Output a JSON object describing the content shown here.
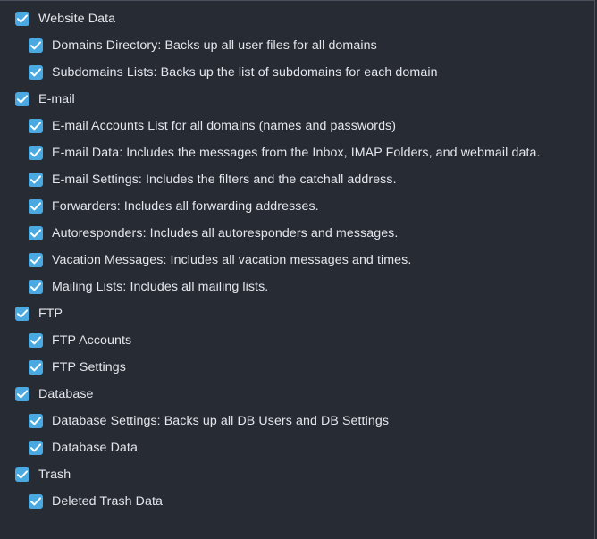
{
  "theme": {
    "background": "#272b34",
    "checkbox_color": "#4aa9e0",
    "text_color": "#e4e7ec"
  },
  "sections": [
    {
      "label": "Website Data",
      "checked": true,
      "items": [
        {
          "label": "Domains Directory: Backs up all user files for all domains",
          "checked": true
        },
        {
          "label": "Subdomains Lists: Backs up the list of subdomains for each domain",
          "checked": true
        }
      ]
    },
    {
      "label": "E-mail",
      "checked": true,
      "items": [
        {
          "label": "E-mail Accounts List for all domains (names and passwords)",
          "checked": true
        },
        {
          "label": "E-mail Data: Includes the messages from the Inbox, IMAP Folders, and webmail data.",
          "checked": true
        },
        {
          "label": "E-mail Settings: Includes the filters and the catchall address.",
          "checked": true
        },
        {
          "label": "Forwarders: Includes all forwarding addresses.",
          "checked": true
        },
        {
          "label": "Autoresponders: Includes all autoresponders and messages.",
          "checked": true
        },
        {
          "label": "Vacation Messages: Includes all vacation messages and times.",
          "checked": true
        },
        {
          "label": "Mailing Lists: Includes all mailing lists.",
          "checked": true
        }
      ]
    },
    {
      "label": "FTP",
      "checked": true,
      "items": [
        {
          "label": "FTP Accounts",
          "checked": true
        },
        {
          "label": "FTP Settings",
          "checked": true
        }
      ]
    },
    {
      "label": "Database",
      "checked": true,
      "items": [
        {
          "label": "Database Settings: Backs up all DB Users and DB Settings",
          "checked": true
        },
        {
          "label": "Database Data",
          "checked": true
        }
      ]
    },
    {
      "label": "Trash",
      "checked": true,
      "items": [
        {
          "label": "Deleted Trash Data",
          "checked": true
        }
      ]
    }
  ]
}
